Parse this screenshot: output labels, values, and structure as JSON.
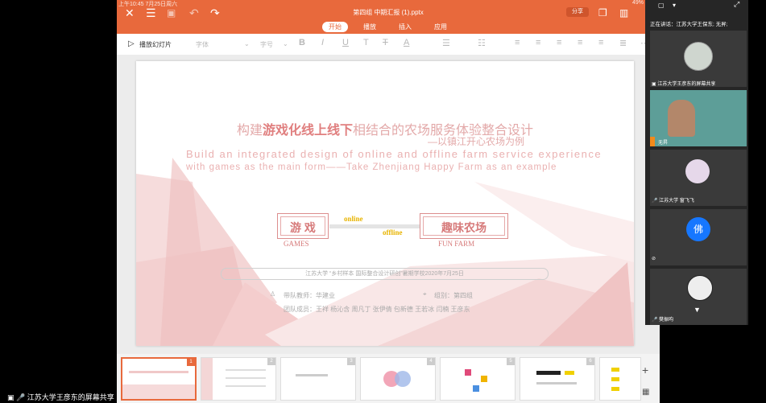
{
  "system": {
    "time": "上午10:45  7月25日周六",
    "battery": "49%"
  },
  "app": {
    "doc_title": "第四组 中期汇报 (1).pptx",
    "share": "分享",
    "tabs": [
      "开始",
      "播放",
      "插入",
      "应用"
    ],
    "toolbar": {
      "play_label": "播放幻灯片",
      "font_placeholder": "字体",
      "size_placeholder": "字号"
    }
  },
  "slide": {
    "title_cn_1": "构建",
    "title_cn_bold1": "游戏化线上线下",
    "title_cn_2": "相结合的农场服务体验整合设计",
    "subtitle_cn": "—以镇江开心农场为例",
    "title_en_1": "Build  an  integrated  design  of  online  and  offline  farm  service  experience",
    "title_en_2": "with  games  as  the  main  form——Take  Zhenjiang  Happy  Farm  as  an  example",
    "games_cn": "游 戏",
    "games_en": "GAMES",
    "online": "online",
    "offline": "offline",
    "farm_cn": "趣味农场",
    "farm_en": "FUN FARM",
    "info": "江苏大学 “乡村样本 国际整合设计研创”暑期学校2020年7月25日",
    "teacher": "带队教师：华建业",
    "group": "组别：第四组",
    "members": "团队成员：王祥 杨沁含 周凡丁 张伊倩 包新德 王若冰 闫楠 王彦东"
  },
  "thumbnails": [
    "1",
    "2",
    "3",
    "4",
    "5",
    "6"
  ],
  "meeting": {
    "speaking": "正在讲话：江苏大学王保东; 无昇;",
    "participants": [
      {
        "name": "江苏大学王彦东的屏幕共享"
      },
      {
        "name": "无昇"
      },
      {
        "name": "江苏大学 窗飞飞"
      },
      {
        "name": "佛",
        "initial": "佛"
      },
      {
        "name": "樊振昀"
      }
    ]
  },
  "footer": {
    "share_label": "江苏大学王彦东的屏幕共享"
  }
}
